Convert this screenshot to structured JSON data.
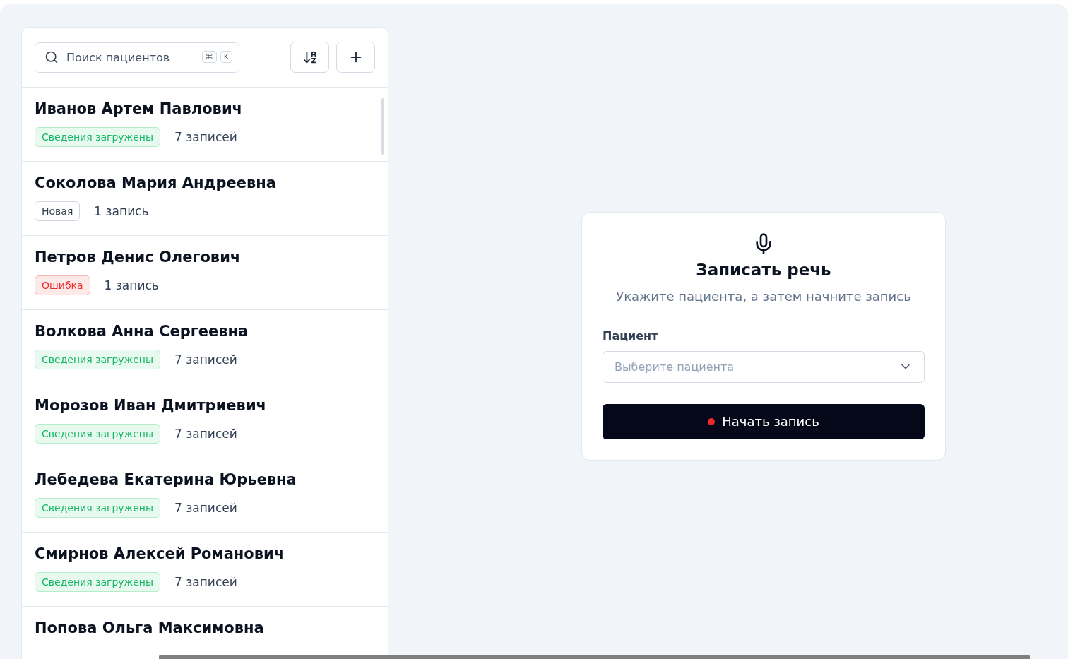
{
  "search": {
    "placeholder": "Поиск пациентов",
    "shortcut_keys": [
      "⌘",
      "K"
    ]
  },
  "patients": [
    {
      "name": "Иванов Артем Павлович",
      "status": {
        "kind": "loaded",
        "label": "Сведения загружены"
      },
      "records": "7 записей"
    },
    {
      "name": "Соколова Мария Андреевна",
      "status": {
        "kind": "new",
        "label": "Новая"
      },
      "records": "1 запись"
    },
    {
      "name": "Петров Денис Олегович",
      "status": {
        "kind": "error",
        "label": "Ошибка"
      },
      "records": "1 запись"
    },
    {
      "name": "Волкова Анна Сергеевна",
      "status": {
        "kind": "loaded",
        "label": "Сведения загружены"
      },
      "records": "7 записей"
    },
    {
      "name": "Морозов Иван Дмитриевич",
      "status": {
        "kind": "loaded",
        "label": "Сведения загружены"
      },
      "records": "7 записей"
    },
    {
      "name": "Лебедева Екатерина Юрьевна",
      "status": {
        "kind": "loaded",
        "label": "Сведения загружены"
      },
      "records": "7 записей"
    },
    {
      "name": "Смирнов Алексей Романович",
      "status": {
        "kind": "loaded",
        "label": "Сведения загружены"
      },
      "records": "7 записей"
    },
    {
      "name": "Попова Ольга Максимовна"
    }
  ],
  "recorder": {
    "title": "Записать речь",
    "subtitle": "Укажите пациента, а затем начните запись",
    "field_label": "Пациент",
    "select_placeholder": "Выберите пациента",
    "button": "Начать запись"
  }
}
